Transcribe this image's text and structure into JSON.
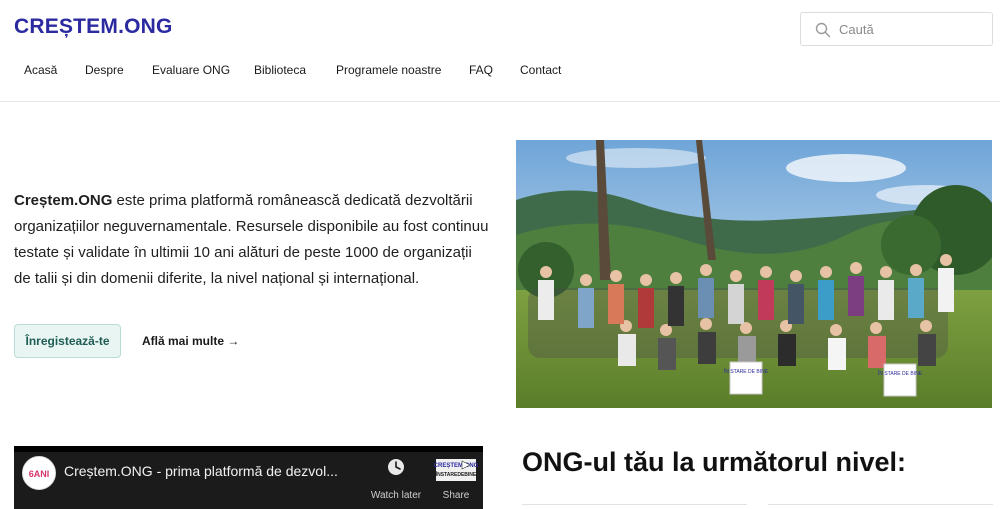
{
  "header": {
    "logo": "CREȘTEM.ONG",
    "search": {
      "placeholder": "Caută"
    },
    "nav": [
      "Acasă",
      "Despre",
      "Evaluare ONG",
      "Biblioteca",
      "Programele noastre",
      "FAQ",
      "Contact"
    ]
  },
  "hero": {
    "brand": "Creștem.ONG",
    "text": " este prima platformă românească dedicată dezvoltării organizațiilor neguvernamentale. Resursele disponibile au fost continuu testate și validate în ultimii 10 ani alături de peste 1000 de organizații de talii și din domenii diferite, la nivel național și internațional.",
    "register_label": "Înregistează-te",
    "more_label": "Află mai multe →",
    "photo_signs": [
      "ÎN STARE DE BINE",
      "ÎN STARE DE BINE"
    ]
  },
  "video": {
    "channel_badge": "6ANI",
    "title": "Creștem.ONG - prima platformă de dezvol...",
    "watch_later": "Watch later",
    "share": "Share",
    "share_logo": "CREȘTEM.ONG",
    "share_sub": "ÎNSTAREDEBINE"
  },
  "section": {
    "title": "ONG-ul tău la următorul nivel:"
  },
  "colors": {
    "brand": "#2b2aa0",
    "accent": "#e9f5f3",
    "accent_text": "#1f5d55"
  }
}
